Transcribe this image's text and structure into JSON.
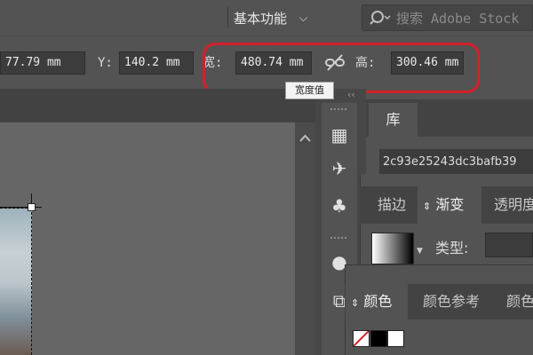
{
  "topbar": {
    "workspace_label": "基本功能",
    "workspace_chevron_icon": "chevron-down-icon",
    "search_placeholder": "搜索 Adobe Stock",
    "search_icon": "search-icon"
  },
  "transform": {
    "x_value": "77.79 mm",
    "y_label": "Y:",
    "y_value": "140.2 mm",
    "w_label": "宽:",
    "w_value": "480.74 mm",
    "h_label": "高:",
    "h_value": "300.46 mm",
    "link_icon": "unlink-icon",
    "tooltip": "宽度值"
  },
  "dock": {
    "icons": [
      "libraries-icon",
      "brushes-icon",
      "symbols-icon",
      "appearance-icon",
      "export-icon"
    ]
  },
  "panels": {
    "library": {
      "tab": "库",
      "library_name": "2c93e25243dc3bafb39"
    },
    "gradient": {
      "tabs": [
        "描边",
        "渐变",
        "透明度"
      ],
      "active_tab": "渐变",
      "type_label": "类型:"
    },
    "color": {
      "tabs": [
        "颜色",
        "颜色参考",
        "颜色"
      ],
      "active_tab": "颜色"
    }
  },
  "colors": {
    "highlight": "#d3202a",
    "panel_bg": "#535353",
    "canvas_bg": "#666666"
  }
}
